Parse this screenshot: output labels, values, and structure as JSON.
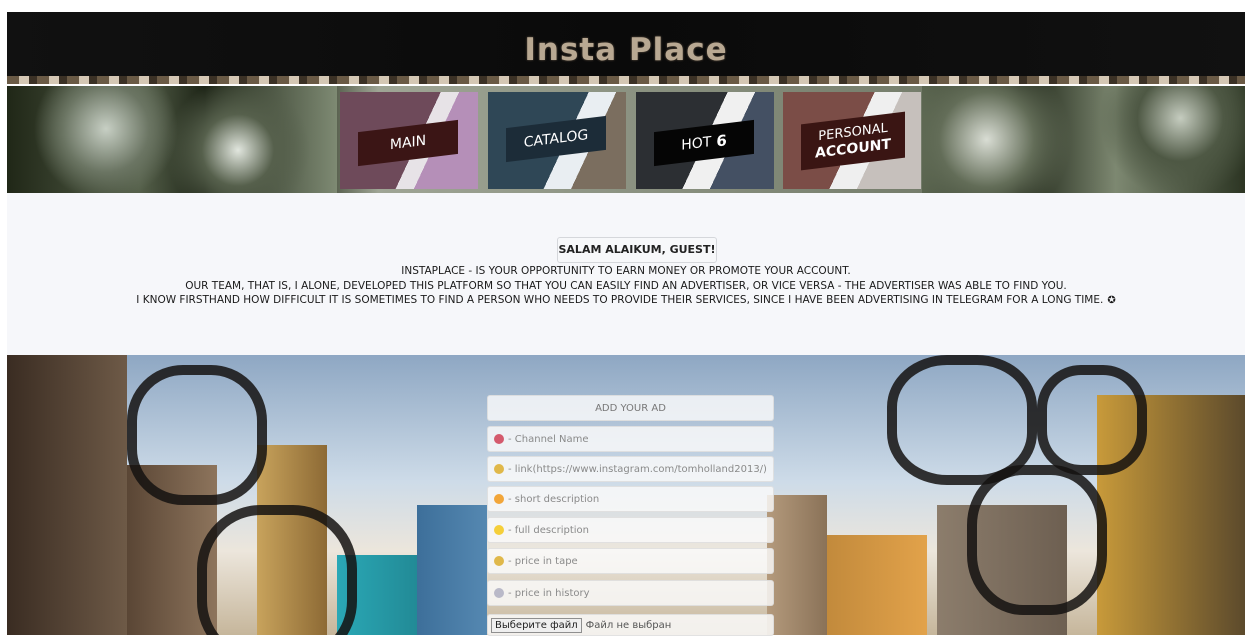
{
  "caption": "",
  "header": {
    "title": "Insta Place"
  },
  "nav": {
    "main": "MAIN",
    "catalog": "CATALOG",
    "hot_prefix": "HOT",
    "hot_number": "6",
    "account_line1": "PERSONAL",
    "account_line2": "ACCOUNT"
  },
  "welcome": {
    "greeting": "SALAM ALAIKUM, GUEST!",
    "line1": "INSTAPLACE - IS YOUR OPPORTUNITY TO EARN MONEY OR PROMOTE YOUR ACCOUNT.",
    "line2": "OUR TEAM, THAT IS, I ALONE, DEVELOPED THIS PLATFORM SO THAT YOU CAN EASILY FIND AN ADVERTISER, OR VICE VERSA - THE ADVERTISER WAS ABLE TO FIND YOU.",
    "line3": "I KNOW FIRSTHAND HOW DIFFICULT IT IS SOMETIMES TO FIND A PERSON WHO NEEDS TO PROVIDE THEIR SERVICES, SINCE I HAVE BEEN ADVERTISING IN TELEGRAM FOR A LONG TIME.",
    "line3_icon": "✪"
  },
  "form": {
    "title": "ADD YOUR AD",
    "channel_name": "- Channel Name",
    "link": "- link(https://www.instagram.com/tomholland2013/)",
    "short_description": "- short description",
    "full_description": "- full description",
    "price_tape": "- price in tape",
    "price_history": "- price in history",
    "file_button": "Выберите файл",
    "file_status": "Файл не выбран"
  },
  "colors": {
    "header_bg": "#030303",
    "title_color": "#b8a892",
    "welcome_bg": "#f6f7fa"
  }
}
